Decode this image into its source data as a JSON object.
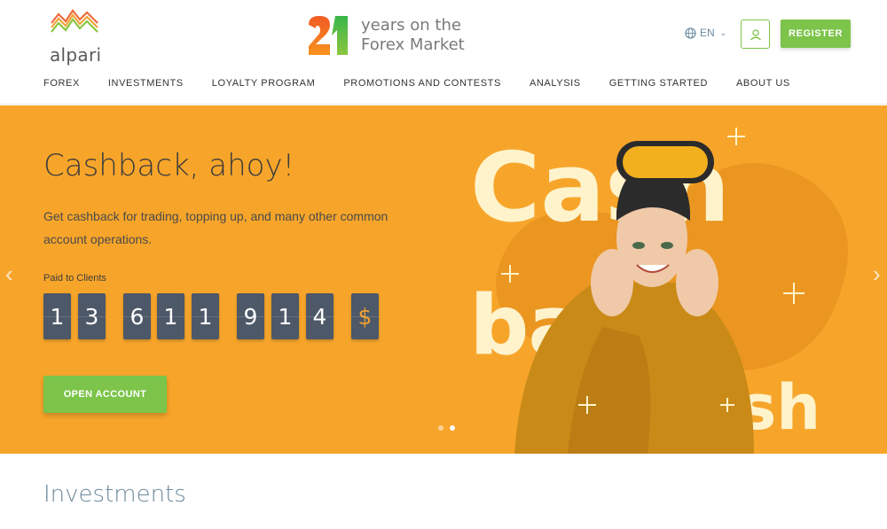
{
  "brand": {
    "logo_text": "alpari",
    "accent": "#7cc44a",
    "hero_bg": "#f7a52a"
  },
  "anniversary": {
    "number": "21",
    "line1": "years on the",
    "line2": "Forex Market"
  },
  "header": {
    "language": "EN",
    "register_label": "REGISTER"
  },
  "nav": [
    "FOREX",
    "INVESTMENTS",
    "LOYALTY PROGRAM",
    "PROMOTIONS AND CONTESTS",
    "ANALYSIS",
    "GETTING STARTED",
    "ABOUT US"
  ],
  "hero": {
    "title": "Cashback, ahoy!",
    "description": "Get cashback for trading, topping up, and many other common account operations.",
    "paid_label": "Paid to Clients",
    "digits": [
      "1",
      "3",
      "6",
      "1",
      "1",
      "9",
      "1",
      "4"
    ],
    "currency": "$",
    "open_account_label": "OPEN ACCOUNT",
    "art_words": [
      "Cash",
      "back",
      "Cash"
    ],
    "slides": 2,
    "active_slide": 2
  },
  "section": {
    "investments_title": "Investments"
  }
}
